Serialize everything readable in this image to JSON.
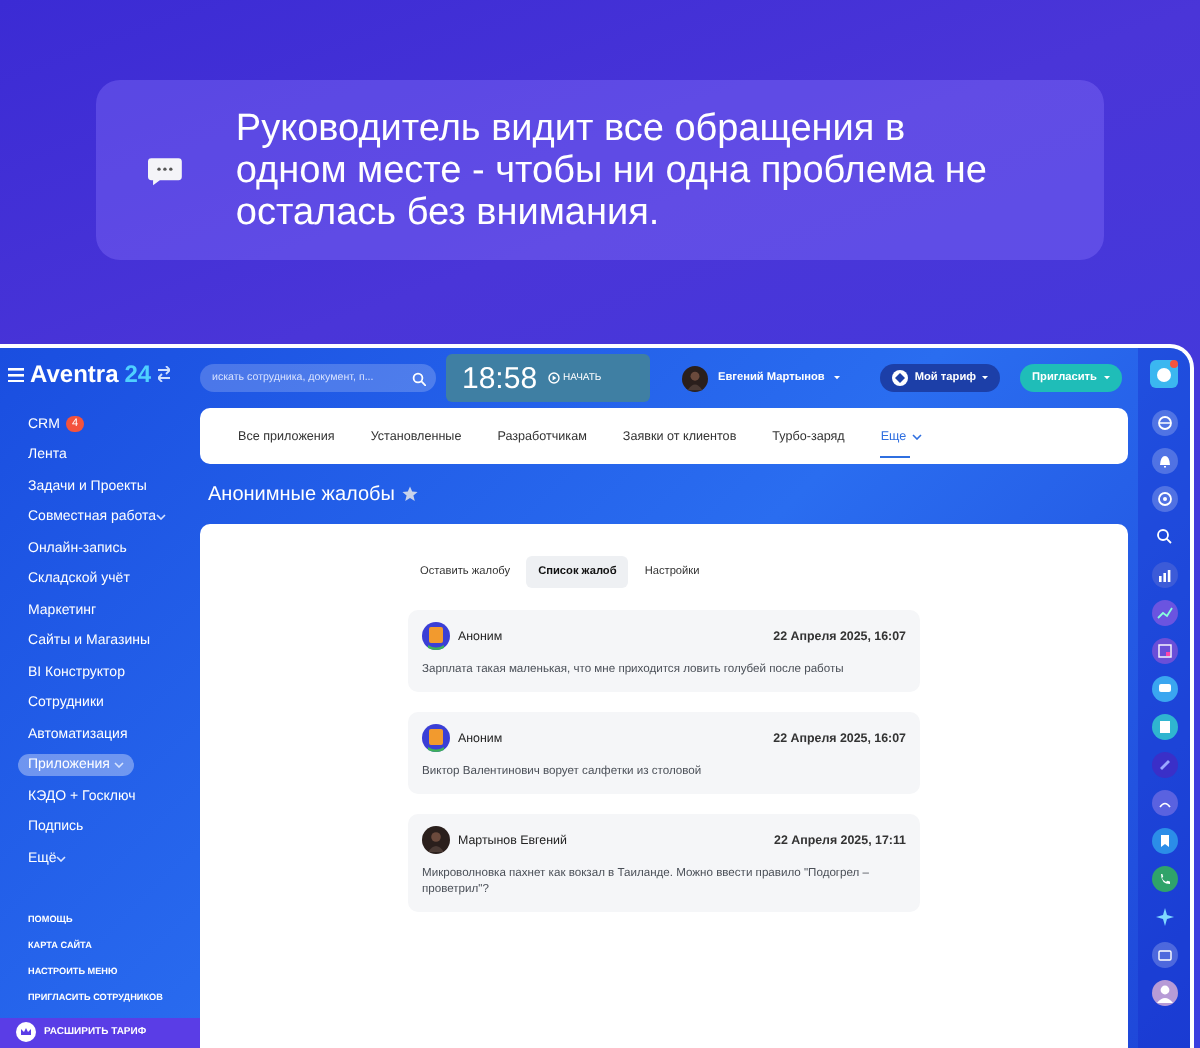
{
  "banner": {
    "text": "Руководитель видит все обращения в одном месте - чтобы ни одна проблема не осталась без внимания."
  },
  "logo": {
    "name": "Aventra",
    "suffix": "24"
  },
  "search": {
    "placeholder": "искать сотрудника, документ, п..."
  },
  "timer": {
    "time": "18:58",
    "action": "НАЧАТЬ"
  },
  "user": {
    "name": "Евгений Мартынов"
  },
  "tariff_button": "Мой тариф",
  "invite_button": "Пригласить",
  "sidebar": {
    "items": [
      {
        "label": "CRM",
        "badge": "4",
        "expandable": false,
        "selected": false
      },
      {
        "label": "Лента",
        "expandable": false,
        "selected": false
      },
      {
        "label": "Задачи и Проекты",
        "expandable": false,
        "selected": false
      },
      {
        "label": "Совместная работа",
        "expandable": true,
        "selected": false
      },
      {
        "label": "Онлайн-запись",
        "expandable": false,
        "selected": false
      },
      {
        "label": "Складской учёт",
        "expandable": false,
        "selected": false
      },
      {
        "label": "Маркетинг",
        "expandable": false,
        "selected": false
      },
      {
        "label": "Сайты и Магазины",
        "expandable": false,
        "selected": false
      },
      {
        "label": "BI Конструктор",
        "expandable": false,
        "selected": false
      },
      {
        "label": "Сотрудники",
        "expandable": false,
        "selected": false
      },
      {
        "label": "Автоматизация",
        "expandable": false,
        "selected": false
      },
      {
        "label": "Приложения",
        "expandable": true,
        "selected": true
      },
      {
        "label": "КЭДО + Госключ",
        "expandable": false,
        "selected": false
      },
      {
        "label": "Подпись",
        "expandable": false,
        "selected": false
      },
      {
        "label": "Ещё",
        "expandable": true,
        "selected": false
      }
    ],
    "links": [
      "ПОМОЩЬ",
      "КАРТА САЙТА",
      "НАСТРОИТЬ МЕНЮ",
      "ПРИГЛАСИТЬ СОТРУДНИКОВ"
    ],
    "upgrade": "РАСШИРИТЬ ТАРИФ"
  },
  "tabs": [
    {
      "label": "Все приложения",
      "has_menu": false,
      "selected": false
    },
    {
      "label": "Установленные",
      "has_menu": false,
      "selected": false
    },
    {
      "label": "Разработчикам",
      "has_menu": false,
      "selected": false
    },
    {
      "label": "Заявки от клиентов",
      "has_menu": false,
      "selected": false
    },
    {
      "label": "Турбо-заряд",
      "has_menu": false,
      "selected": false
    },
    {
      "label": "Еще",
      "has_menu": true,
      "selected": true
    }
  ],
  "page_title": "Анонимные жалобы",
  "subtabs": [
    {
      "label": "Оставить жалобу",
      "selected": false
    },
    {
      "label": "Список жалоб",
      "selected": true
    },
    {
      "label": "Настройки",
      "selected": false
    }
  ],
  "complaints": [
    {
      "author": "Аноним",
      "kind": "anonymous",
      "date": "22 Апреля 2025, 16:07",
      "text": "Зарплата такая маленькая, что мне приходится ловить голубей после работы"
    },
    {
      "author": "Аноним",
      "kind": "anonymous",
      "date": "22 Апреля 2025, 16:07",
      "text": "Виктор Валентинович ворует салфетки из столовой"
    },
    {
      "author": "Мартынов Евгений",
      "kind": "person",
      "date": "22 Апреля 2025, 17:11",
      "text": "Микроволновка пахнет как вокзал в Таиланде. Можно ввести правило \"Подогрел – проветрил\"?"
    }
  ]
}
